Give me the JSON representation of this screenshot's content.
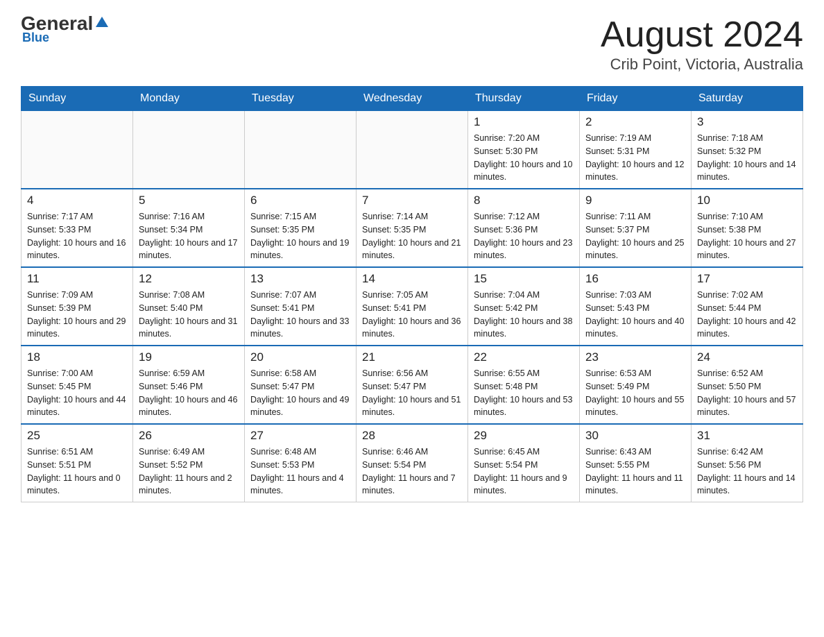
{
  "header": {
    "logo_general": "General",
    "logo_triangle": "▶",
    "logo_blue": "Blue",
    "title": "August 2024",
    "subtitle": "Crib Point, Victoria, Australia"
  },
  "weekdays": [
    "Sunday",
    "Monday",
    "Tuesday",
    "Wednesday",
    "Thursday",
    "Friday",
    "Saturday"
  ],
  "weeks": [
    [
      {
        "day": "",
        "sunrise": "",
        "sunset": "",
        "daylight": ""
      },
      {
        "day": "",
        "sunrise": "",
        "sunset": "",
        "daylight": ""
      },
      {
        "day": "",
        "sunrise": "",
        "sunset": "",
        "daylight": ""
      },
      {
        "day": "",
        "sunrise": "",
        "sunset": "",
        "daylight": ""
      },
      {
        "day": "1",
        "sunrise": "Sunrise: 7:20 AM",
        "sunset": "Sunset: 5:30 PM",
        "daylight": "Daylight: 10 hours and 10 minutes."
      },
      {
        "day": "2",
        "sunrise": "Sunrise: 7:19 AM",
        "sunset": "Sunset: 5:31 PM",
        "daylight": "Daylight: 10 hours and 12 minutes."
      },
      {
        "day": "3",
        "sunrise": "Sunrise: 7:18 AM",
        "sunset": "Sunset: 5:32 PM",
        "daylight": "Daylight: 10 hours and 14 minutes."
      }
    ],
    [
      {
        "day": "4",
        "sunrise": "Sunrise: 7:17 AM",
        "sunset": "Sunset: 5:33 PM",
        "daylight": "Daylight: 10 hours and 16 minutes."
      },
      {
        "day": "5",
        "sunrise": "Sunrise: 7:16 AM",
        "sunset": "Sunset: 5:34 PM",
        "daylight": "Daylight: 10 hours and 17 minutes."
      },
      {
        "day": "6",
        "sunrise": "Sunrise: 7:15 AM",
        "sunset": "Sunset: 5:35 PM",
        "daylight": "Daylight: 10 hours and 19 minutes."
      },
      {
        "day": "7",
        "sunrise": "Sunrise: 7:14 AM",
        "sunset": "Sunset: 5:35 PM",
        "daylight": "Daylight: 10 hours and 21 minutes."
      },
      {
        "day": "8",
        "sunrise": "Sunrise: 7:12 AM",
        "sunset": "Sunset: 5:36 PM",
        "daylight": "Daylight: 10 hours and 23 minutes."
      },
      {
        "day": "9",
        "sunrise": "Sunrise: 7:11 AM",
        "sunset": "Sunset: 5:37 PM",
        "daylight": "Daylight: 10 hours and 25 minutes."
      },
      {
        "day": "10",
        "sunrise": "Sunrise: 7:10 AM",
        "sunset": "Sunset: 5:38 PM",
        "daylight": "Daylight: 10 hours and 27 minutes."
      }
    ],
    [
      {
        "day": "11",
        "sunrise": "Sunrise: 7:09 AM",
        "sunset": "Sunset: 5:39 PM",
        "daylight": "Daylight: 10 hours and 29 minutes."
      },
      {
        "day": "12",
        "sunrise": "Sunrise: 7:08 AM",
        "sunset": "Sunset: 5:40 PM",
        "daylight": "Daylight: 10 hours and 31 minutes."
      },
      {
        "day": "13",
        "sunrise": "Sunrise: 7:07 AM",
        "sunset": "Sunset: 5:41 PM",
        "daylight": "Daylight: 10 hours and 33 minutes."
      },
      {
        "day": "14",
        "sunrise": "Sunrise: 7:05 AM",
        "sunset": "Sunset: 5:41 PM",
        "daylight": "Daylight: 10 hours and 36 minutes."
      },
      {
        "day": "15",
        "sunrise": "Sunrise: 7:04 AM",
        "sunset": "Sunset: 5:42 PM",
        "daylight": "Daylight: 10 hours and 38 minutes."
      },
      {
        "day": "16",
        "sunrise": "Sunrise: 7:03 AM",
        "sunset": "Sunset: 5:43 PM",
        "daylight": "Daylight: 10 hours and 40 minutes."
      },
      {
        "day": "17",
        "sunrise": "Sunrise: 7:02 AM",
        "sunset": "Sunset: 5:44 PM",
        "daylight": "Daylight: 10 hours and 42 minutes."
      }
    ],
    [
      {
        "day": "18",
        "sunrise": "Sunrise: 7:00 AM",
        "sunset": "Sunset: 5:45 PM",
        "daylight": "Daylight: 10 hours and 44 minutes."
      },
      {
        "day": "19",
        "sunrise": "Sunrise: 6:59 AM",
        "sunset": "Sunset: 5:46 PM",
        "daylight": "Daylight: 10 hours and 46 minutes."
      },
      {
        "day": "20",
        "sunrise": "Sunrise: 6:58 AM",
        "sunset": "Sunset: 5:47 PM",
        "daylight": "Daylight: 10 hours and 49 minutes."
      },
      {
        "day": "21",
        "sunrise": "Sunrise: 6:56 AM",
        "sunset": "Sunset: 5:47 PM",
        "daylight": "Daylight: 10 hours and 51 minutes."
      },
      {
        "day": "22",
        "sunrise": "Sunrise: 6:55 AM",
        "sunset": "Sunset: 5:48 PM",
        "daylight": "Daylight: 10 hours and 53 minutes."
      },
      {
        "day": "23",
        "sunrise": "Sunrise: 6:53 AM",
        "sunset": "Sunset: 5:49 PM",
        "daylight": "Daylight: 10 hours and 55 minutes."
      },
      {
        "day": "24",
        "sunrise": "Sunrise: 6:52 AM",
        "sunset": "Sunset: 5:50 PM",
        "daylight": "Daylight: 10 hours and 57 minutes."
      }
    ],
    [
      {
        "day": "25",
        "sunrise": "Sunrise: 6:51 AM",
        "sunset": "Sunset: 5:51 PM",
        "daylight": "Daylight: 11 hours and 0 minutes."
      },
      {
        "day": "26",
        "sunrise": "Sunrise: 6:49 AM",
        "sunset": "Sunset: 5:52 PM",
        "daylight": "Daylight: 11 hours and 2 minutes."
      },
      {
        "day": "27",
        "sunrise": "Sunrise: 6:48 AM",
        "sunset": "Sunset: 5:53 PM",
        "daylight": "Daylight: 11 hours and 4 minutes."
      },
      {
        "day": "28",
        "sunrise": "Sunrise: 6:46 AM",
        "sunset": "Sunset: 5:54 PM",
        "daylight": "Daylight: 11 hours and 7 minutes."
      },
      {
        "day": "29",
        "sunrise": "Sunrise: 6:45 AM",
        "sunset": "Sunset: 5:54 PM",
        "daylight": "Daylight: 11 hours and 9 minutes."
      },
      {
        "day": "30",
        "sunrise": "Sunrise: 6:43 AM",
        "sunset": "Sunset: 5:55 PM",
        "daylight": "Daylight: 11 hours and 11 minutes."
      },
      {
        "day": "31",
        "sunrise": "Sunrise: 6:42 AM",
        "sunset": "Sunset: 5:56 PM",
        "daylight": "Daylight: 11 hours and 14 minutes."
      }
    ]
  ]
}
